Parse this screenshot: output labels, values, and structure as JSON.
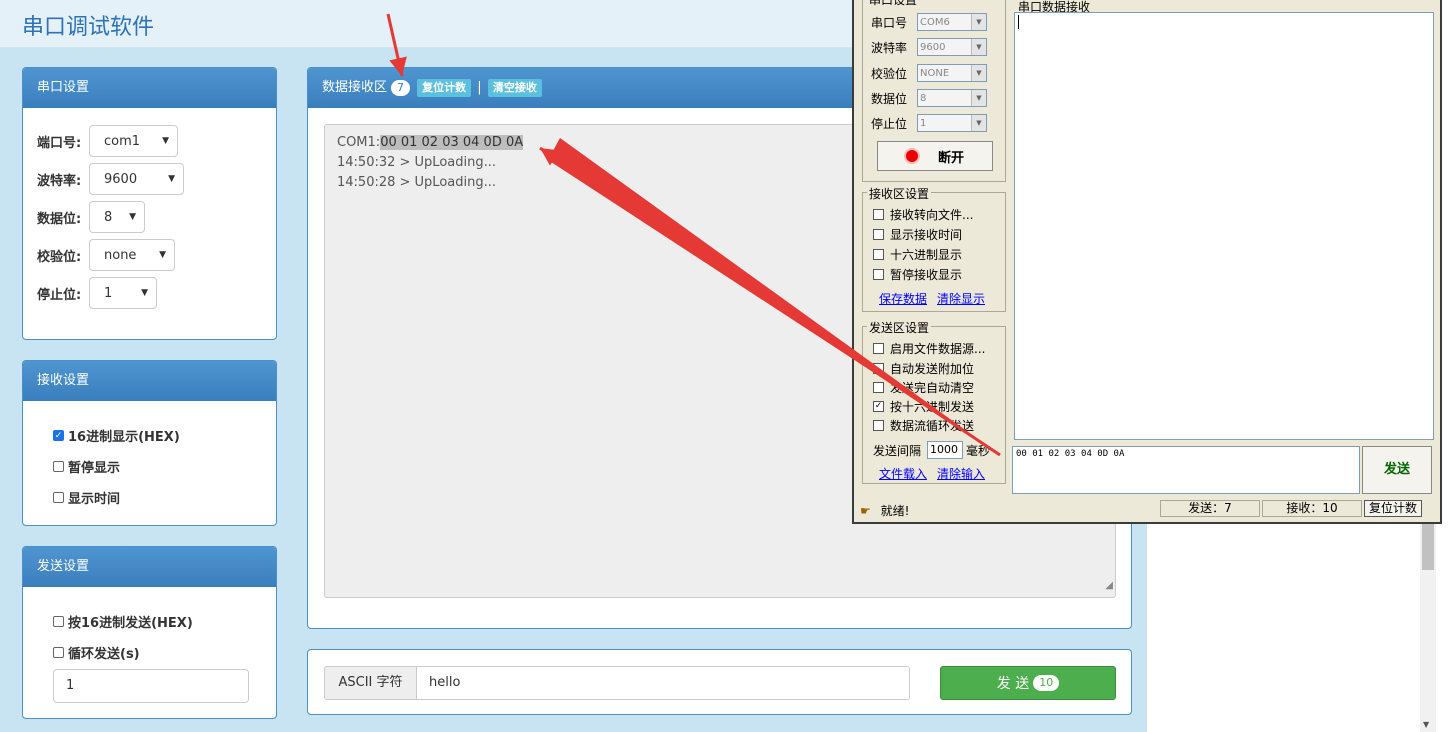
{
  "app": {
    "title": "串口调试软件"
  },
  "serial_settings": {
    "title": "串口设置",
    "rows": [
      {
        "label": "端口号:",
        "value": "com1"
      },
      {
        "label": "波特率:",
        "value": "9600"
      },
      {
        "label": "数据位:",
        "value": "8"
      },
      {
        "label": "校验位:",
        "value": "none"
      },
      {
        "label": "停止位:",
        "value": "1"
      }
    ]
  },
  "receive_settings": {
    "title": "接收设置",
    "options": [
      {
        "label": "16进制显示(HEX)",
        "checked": true
      },
      {
        "label": "暂停显示",
        "checked": false
      },
      {
        "label": "显示时间",
        "checked": false
      }
    ]
  },
  "send_settings": {
    "title": "发送设置",
    "options": [
      {
        "label": "按16进制发送(HEX)",
        "checked": false
      },
      {
        "label": "循环发送(s)",
        "checked": false
      }
    ],
    "interval_value": "1"
  },
  "receive_area": {
    "title": "数据接收区",
    "count": "7",
    "reset_label": "复位计数",
    "separator": "|",
    "clear_label": "清空接收",
    "lines": [
      {
        "prefix": "COM1:",
        "hex": "00 01 02 03 04 0D 0A"
      },
      {
        "text": "14:50:32 > UpLoading..."
      },
      {
        "text": "14:50:28 > UpLoading..."
      }
    ]
  },
  "send_bar": {
    "mode_label": "ASCII 字符",
    "input_value": "hello",
    "send_label": "发 送",
    "send_count": "10"
  },
  "native_window": {
    "port_group_title": "串口设置",
    "port_rows": [
      {
        "label": "串口号",
        "value": "COM6"
      },
      {
        "label": "波特率",
        "value": "9600"
      },
      {
        "label": "校验位",
        "value": "NONE"
      },
      {
        "label": "数据位",
        "value": "8"
      },
      {
        "label": "停止位",
        "value": "1"
      }
    ],
    "disconnect_label": "断开",
    "recv_group_title": "接收区设置",
    "recv_options": [
      {
        "label": "接收转向文件...",
        "checked": false
      },
      {
        "label": "显示接收时间",
        "checked": false
      },
      {
        "label": "十六进制显示",
        "checked": false
      },
      {
        "label": "暂停接收显示",
        "checked": false
      }
    ],
    "save_link": "保存数据",
    "clear_display_link": "清除显示",
    "send_group_title": "发送区设置",
    "send_options": [
      {
        "label": "启用文件数据源...",
        "checked": false
      },
      {
        "label": "自动发送附加位",
        "checked": false
      },
      {
        "label": "发送完自动清空",
        "checked": false
      },
      {
        "label": "按十六进制发送",
        "checked": true
      },
      {
        "label": "数据流循环发送",
        "checked": false
      }
    ],
    "interval_label": "发送间隔",
    "interval_value": "1000",
    "interval_unit": "毫秒",
    "file_load_link": "文件载入",
    "clear_input_link": "清除输入",
    "recv_area_title": "串口数据接收",
    "send_text": "00 01 02 03 04 0D 0A",
    "send_button": "发送",
    "status_ready": "就绪!",
    "status_sent": "发送：7",
    "status_recv": "接收：10",
    "status_reset": "复位计数"
  },
  "colors": {
    "accent": "#3a7fbd",
    "send_green": "#4cae4c",
    "arrow_red": "#e53935"
  }
}
